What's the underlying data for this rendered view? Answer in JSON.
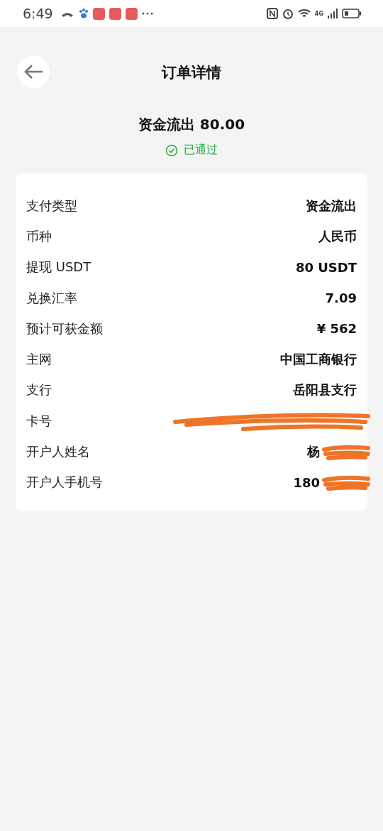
{
  "status_bar": {
    "time": "6:49",
    "network": "4G"
  },
  "header": {
    "title": "订单详情"
  },
  "summary": {
    "title": "资金流出 80.00",
    "status": "已通过",
    "approved": true
  },
  "details": [
    {
      "label": "支付类型",
      "value": "资金流出",
      "kind": "plain"
    },
    {
      "label": "币种",
      "value": "人民币",
      "kind": "plain"
    },
    {
      "label": "提现 USDT",
      "value": "80 USDT",
      "kind": "plain"
    },
    {
      "label": "兑换汇率",
      "value": "7.09",
      "kind": "plain"
    },
    {
      "label": "预计可获金额",
      "value": "¥  562",
      "kind": "plain"
    },
    {
      "label": "主网",
      "value": "中国工商银行",
      "kind": "plain"
    },
    {
      "label": "支行",
      "value": "岳阳县支行",
      "kind": "plain"
    },
    {
      "label": "卡号",
      "kind": "redacted"
    },
    {
      "label": "开户人姓名",
      "value": "杨",
      "kind": "redacted"
    },
    {
      "label": "开户人手机号",
      "value": "180",
      "kind": "redacted"
    }
  ]
}
